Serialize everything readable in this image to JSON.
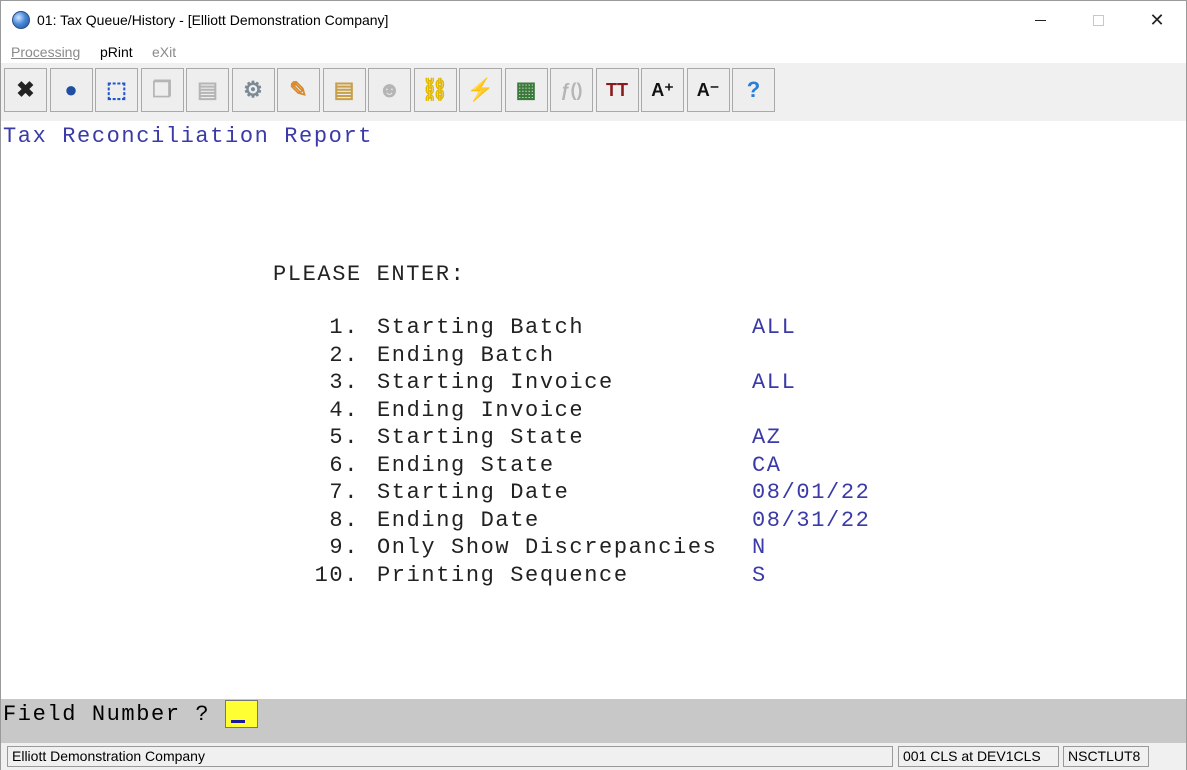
{
  "window": {
    "title": "01: Tax Queue/History - [Elliott Demonstration Company]",
    "minimize_glyph": "",
    "close_glyph": "✕"
  },
  "menu": {
    "processing": "Processing",
    "print": "pRint",
    "exit": "eXit"
  },
  "toolbar": {
    "buttons": [
      {
        "name": "close-icon",
        "glyph": "✖",
        "color": "#222222",
        "enabled": true
      },
      {
        "name": "globe-icon",
        "glyph": "●",
        "color": "#1f4fa3",
        "enabled": true
      },
      {
        "name": "select-icon",
        "glyph": "⬚",
        "color": "#2255cc",
        "enabled": true
      },
      {
        "name": "copy-icon",
        "glyph": "❐",
        "color": "#b5b5b5",
        "enabled": false
      },
      {
        "name": "paste-icon",
        "glyph": "▤",
        "color": "#b5b5b5",
        "enabled": false
      },
      {
        "name": "settings-gear-icon",
        "glyph": "⚙",
        "color": "#7a8a96",
        "enabled": true
      },
      {
        "name": "edit-pencil-icon",
        "glyph": "✎",
        "color": "#d98a2b",
        "enabled": true
      },
      {
        "name": "notes-icon",
        "glyph": "▤",
        "color": "#c9a04a",
        "enabled": true
      },
      {
        "name": "users-icon",
        "glyph": "☻",
        "color": "#b5b5b5",
        "enabled": false
      },
      {
        "name": "link-icon",
        "glyph": "⛓",
        "color": "#e0b800",
        "enabled": true
      },
      {
        "name": "lightning-icon",
        "glyph": "⚡",
        "color": "#e02020",
        "enabled": true
      },
      {
        "name": "calendar-lightning-icon",
        "glyph": "▦",
        "color": "#3a7a3a",
        "enabled": true
      },
      {
        "name": "function-icon",
        "glyph": "ƒ()",
        "color": "#b5b5b5",
        "enabled": false
      },
      {
        "name": "font-size-icon",
        "glyph": "TT",
        "color": "#8b1a1a",
        "enabled": true
      },
      {
        "name": "font-increase-icon",
        "glyph": "A⁺",
        "color": "#111111",
        "enabled": true
      },
      {
        "name": "font-decrease-icon",
        "glyph": "A⁻",
        "color": "#111111",
        "enabled": true
      },
      {
        "name": "help-icon",
        "glyph": "?",
        "color": "#2a7fd4",
        "enabled": true
      }
    ]
  },
  "report": {
    "title": "Tax Reconciliation Report",
    "prompt": "PLEASE ENTER:",
    "fields": [
      {
        "num": "1.",
        "label": "Starting Batch",
        "value": "ALL"
      },
      {
        "num": "2.",
        "label": "Ending Batch",
        "value": ""
      },
      {
        "num": "3.",
        "label": "Starting Invoice",
        "value": "ALL"
      },
      {
        "num": "4.",
        "label": "Ending Invoice",
        "value": ""
      },
      {
        "num": "5.",
        "label": "Starting State",
        "value": "AZ"
      },
      {
        "num": "6.",
        "label": "Ending State",
        "value": "CA"
      },
      {
        "num": "7.",
        "label": "Starting Date",
        "value": "08/01/22"
      },
      {
        "num": "8.",
        "label": "Ending Date",
        "value": "08/31/22"
      },
      {
        "num": "9.",
        "label": "Only Show Discrepancies",
        "value": "N"
      },
      {
        "num": "10.",
        "label": "Printing Sequence",
        "value": "S"
      }
    ]
  },
  "command": {
    "label": "Field Number ?",
    "input_value": ""
  },
  "status": {
    "company": "Elliott Demonstration Company",
    "session": "001 CLS at DEV1CLS",
    "node": "NSCTLUT8"
  },
  "colors": {
    "accent_text": "#3a3aa8",
    "input_highlight": "#ffff33",
    "command_bar": "#c8c8c8"
  }
}
